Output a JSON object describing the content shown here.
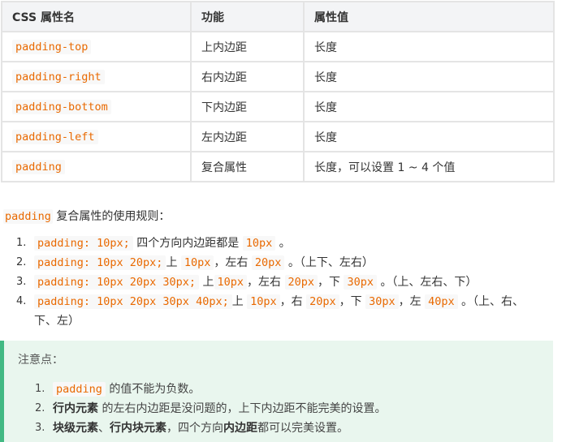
{
  "table": {
    "headers": [
      "CSS 属性名",
      "功能",
      "属性值"
    ],
    "rows": [
      {
        "name": "padding-top",
        "func": "上内边距",
        "value": "长度"
      },
      {
        "name": "padding-right",
        "func": "右内边距",
        "value": "长度"
      },
      {
        "name": "padding-bottom",
        "func": "下内边距",
        "value": "长度"
      },
      {
        "name": "padding-left",
        "func": "左内边距",
        "value": "长度"
      },
      {
        "name": "padding",
        "func": "复合属性",
        "value": "长度，可以设置 1 ~ 4 个值"
      }
    ]
  },
  "intro": {
    "code": "padding",
    "text": "复合属性的使用规则："
  },
  "rules": [
    {
      "num": "1.",
      "code": "padding: 10px;",
      "t1": "四个方向内边距都是",
      "c1": "10px",
      "t2": "。"
    },
    {
      "num": "2.",
      "code": "padding: 10px 20px;",
      "t1": "上",
      "c1": "10px",
      "t2": "，左右",
      "c2": "20px",
      "t3": "。（上下、左右）"
    },
    {
      "num": "3.",
      "code": "padding: 10px 20px 30px;",
      "t1": "上",
      "c1": "10px",
      "t2": "，左右",
      "c2": "20px",
      "t3": "，下",
      "c3": "30px",
      "t4": "。（上、左右、下）"
    },
    {
      "num": "4.",
      "code": "padding: 10px 20px 30px 40px;",
      "t1": "上",
      "c1": "10px",
      "t2": "，右",
      "c2": "20px",
      "t3": "，下",
      "c3": "30px",
      "t4": "，左",
      "c4": "40px",
      "t5": "。（上、右、下、左）"
    }
  ],
  "note": {
    "title": "注意点：",
    "items": [
      {
        "num": "1.",
        "code": "padding",
        "text": "的值不能为负数。"
      },
      {
        "num": "2.",
        "bold": "行内元素",
        "text": "的左右内边距是没问题的，上下内边距不能完美的设置。"
      },
      {
        "num": "3.",
        "bold1": "块级元素",
        "sep": "、",
        "bold2": "行内块元素",
        "text1": "，四个方向",
        "bold3": "内边距",
        "text2": "都可以完美设置。"
      }
    ]
  }
}
